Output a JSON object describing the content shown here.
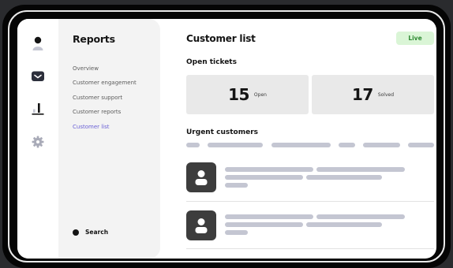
{
  "sidebar": {
    "title": "Reports",
    "items": [
      {
        "label": "Overview",
        "active": false
      },
      {
        "label": "Customer engagement",
        "active": false
      },
      {
        "label": "Customer support",
        "active": false
      },
      {
        "label": "Customer reports",
        "active": false
      },
      {
        "label": "Customer list",
        "active": true
      }
    ],
    "search_label": "Search"
  },
  "rail": {
    "icons": [
      "user-icon",
      "inbox-icon",
      "chart-icon",
      "settings-icon"
    ]
  },
  "main": {
    "title": "Customer list",
    "status_badge": "Live",
    "open_tickets": {
      "title": "Open tickets",
      "open": {
        "count": "15",
        "label": "Open"
      },
      "solved": {
        "count": "17",
        "label": "Solved"
      }
    },
    "urgent": {
      "title": "Urgent customers",
      "rows": 2
    }
  },
  "colors": {
    "accent": "#6b62d6",
    "live_bg": "#daf5d6",
    "live_text": "#2f8a33",
    "placeholder": "#c4c6d2"
  }
}
